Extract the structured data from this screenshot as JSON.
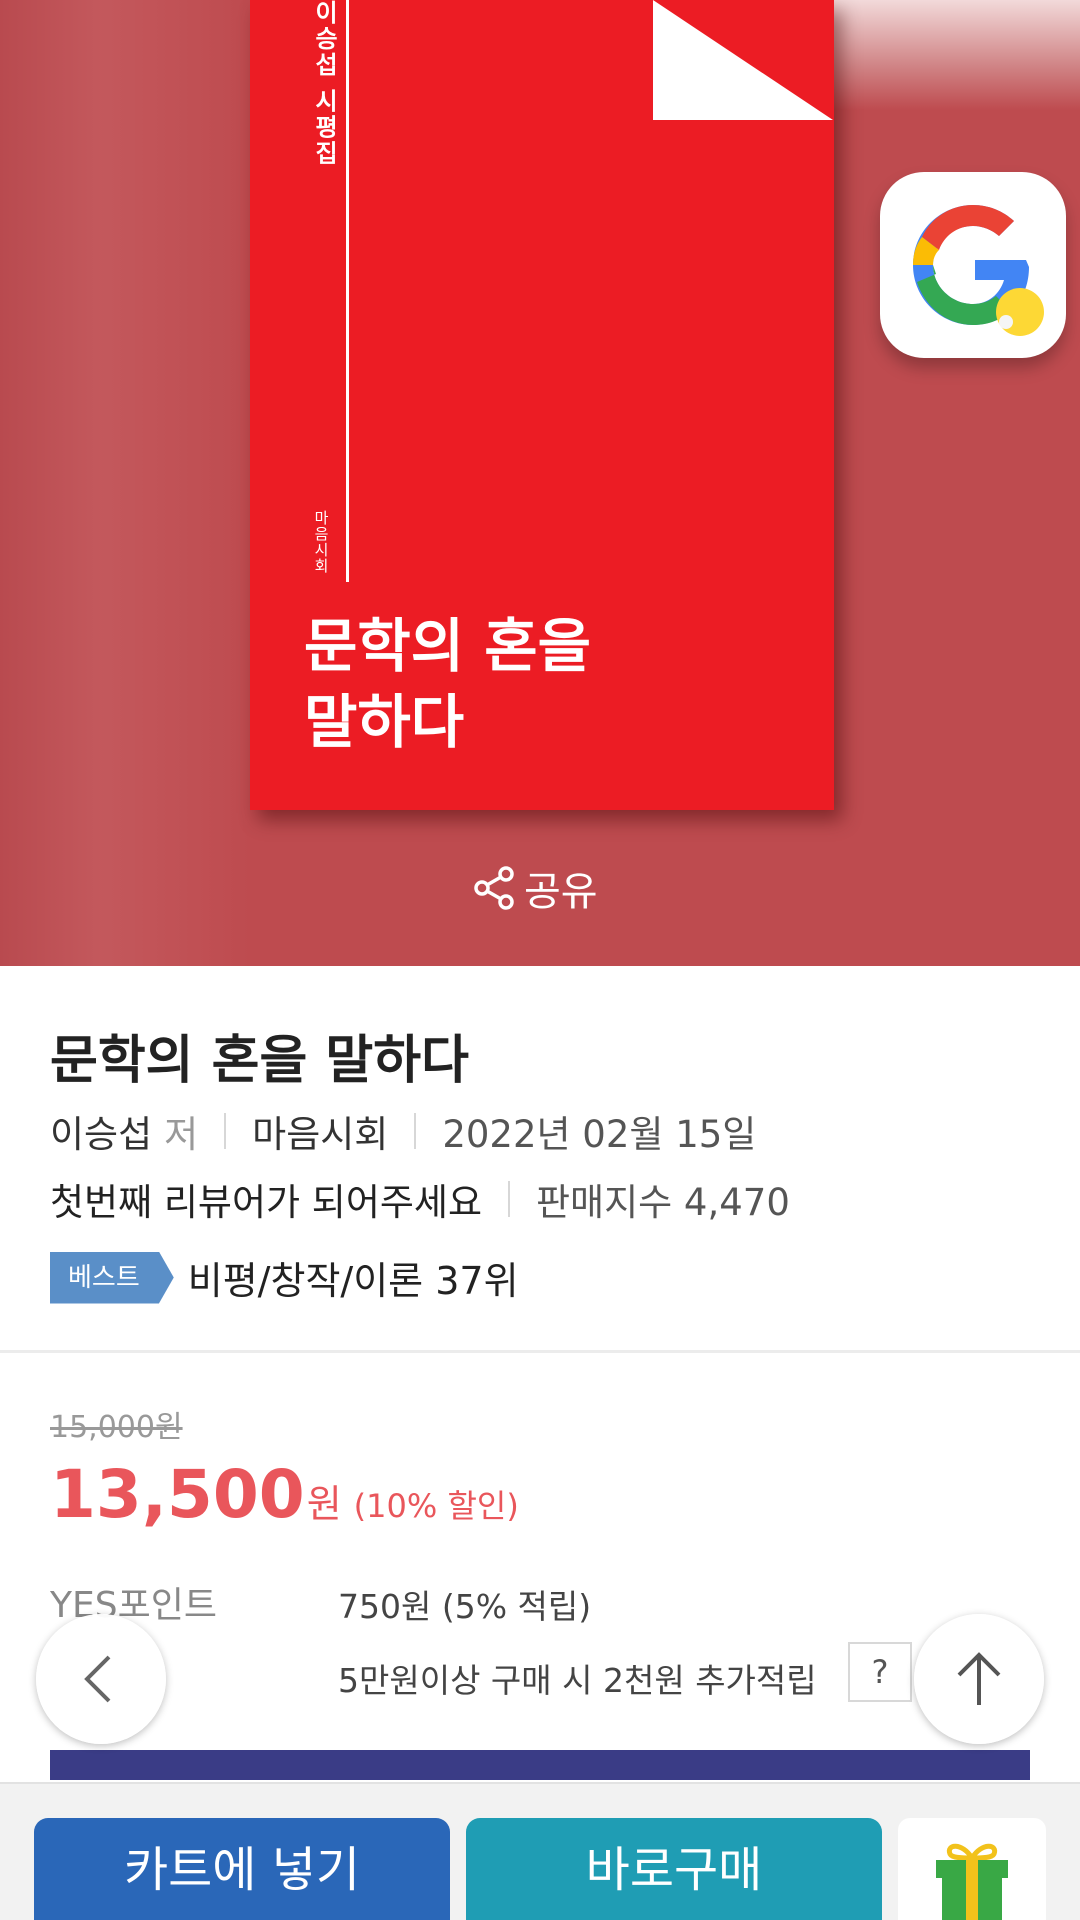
{
  "book_cover": {
    "author_vertical": "이승섭 시평집",
    "publisher_vertical": "마음시회",
    "title_line1": "문학의 혼을",
    "title_line2": "말하다",
    "color": "#ec1c24"
  },
  "overlay_app_icon": "google-app-icon",
  "share": {
    "label": "공유",
    "icon": "share-icon"
  },
  "product": {
    "title": "문학의 혼을 말하다",
    "author": "이승섭",
    "author_suffix": "저",
    "publisher": "마음시회",
    "date": "2022년 02월 15일",
    "review_prompt": "첫번째 리뷰어가 되어주세요",
    "sales_label": "판매지수 4,470",
    "best_badge": "베스트",
    "best_rank": "비평/창작/이론 37위"
  },
  "price": {
    "original": "15,000원",
    "sale_number": "13,500",
    "sale_unit": "원",
    "discount": "(10% 할인)",
    "accent_color": "#e9565b"
  },
  "points": {
    "label": "YES포인트",
    "value": "750원 (5% 적립)",
    "extra": "5만원이상 구매 시 2천원 추가적립",
    "help": "?"
  },
  "floating": {
    "back_icon": "chevron-left-icon",
    "top_icon": "arrow-up-icon"
  },
  "bottom_bar": {
    "cart_label": "카트에 넣기",
    "buy_label": "바로구매",
    "gift_icon": "gift-icon",
    "cart_color": "#2a67b8",
    "buy_color": "#1f9db4"
  }
}
